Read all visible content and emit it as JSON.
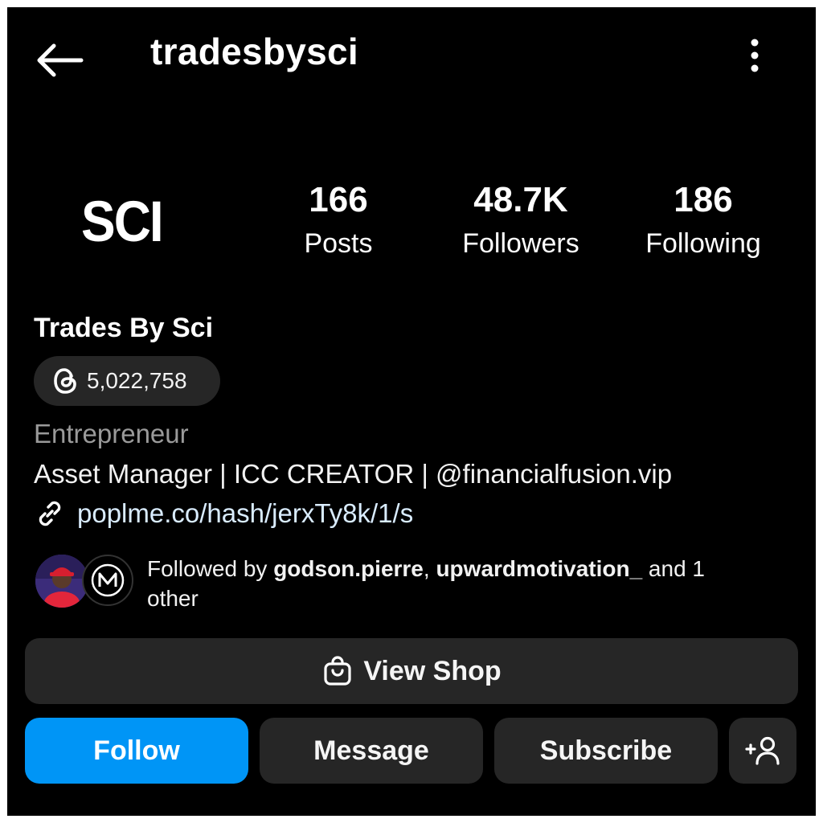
{
  "header": {
    "username": "tradesbysci"
  },
  "profile": {
    "avatar_text": "SCI",
    "display_name": "Trades By Sci",
    "threads_count": "5,022,758",
    "category": "Entrepreneur",
    "bio": "Asset Manager | ICC CREATOR | @financialfusion.vip",
    "link": "poplme.co/hash/jerxTy8k/1/s"
  },
  "stats": [
    {
      "value": "166",
      "label": "Posts"
    },
    {
      "value": "48.7K",
      "label": "Followers"
    },
    {
      "value": "186",
      "label": "Following"
    }
  ],
  "followed_by": {
    "prefix": "Followed by ",
    "user1": "godson.pierre",
    "separator": ", ",
    "user2": "upwardmotivation_",
    "suffix": " and 1 other"
  },
  "buttons": {
    "view_shop": "View Shop",
    "follow": "Follow",
    "message": "Message",
    "subscribe": "Subscribe"
  },
  "colors": {
    "background": "#000000",
    "button": "#262626",
    "accent": "#0095f6"
  },
  "icons": {
    "back": "arrow-left-icon",
    "more": "kebab-menu-icon",
    "threads": "threads-icon",
    "link": "link-icon",
    "shop": "shopping-bag-icon",
    "suggest": "add-person-icon"
  }
}
